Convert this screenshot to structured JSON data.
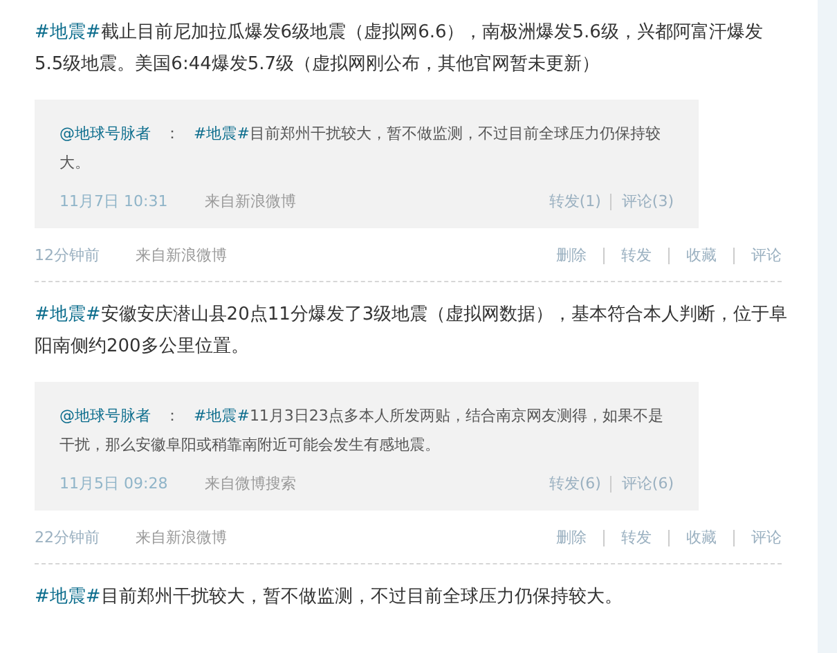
{
  "posts": [
    {
      "topic": "#地震#",
      "text": "截止目前尼加拉瓜爆发6级地震（虚拟网6.6），南极洲爆发5.6级，兴都阿富汗爆发5.5级地震。美国6:44爆发5.7级（虚拟网刚公布，其他官网暂未更新）",
      "quote": {
        "author": "@地球号脉者",
        "colon": "：",
        "topic": "#地震#",
        "text": "目前郑州干扰较大，暂不做监测，不过目前全球压力仍保持较大。",
        "date": "11月7日 10:31",
        "source": "来自新浪微博",
        "actions": [
          "转发(1)",
          "评论(3)"
        ]
      },
      "footer": {
        "time": "12分钟前",
        "source": "来自新浪微博",
        "actions": [
          "删除",
          "转发",
          "收藏",
          "评论"
        ]
      }
    },
    {
      "topic": "#地震#",
      "text": "安徽安庆潜山县20点11分爆发了3级地震（虚拟网数据），基本符合本人判断，位于阜阳南侧约200多公里位置。",
      "quote": {
        "author": "@地球号脉者",
        "colon": "：",
        "topic": "#地震#",
        "text": "11月3日23点多本人所发两贴，结合南京网友测得，如果不是干扰，那么安徽阜阳或稍靠南附近可能会发生有感地震。",
        "date": "11月5日 09:28",
        "source": "来自微博搜索",
        "actions": [
          "转发(6)",
          "评论(6)"
        ]
      },
      "footer": {
        "time": "22分钟前",
        "source": "来自新浪微博",
        "actions": [
          "删除",
          "转发",
          "收藏",
          "评论"
        ]
      }
    },
    {
      "topic": "#地震#",
      "text": "目前郑州干扰较大，暂不做监测，不过目前全球压力仍保持较大。"
    }
  ]
}
